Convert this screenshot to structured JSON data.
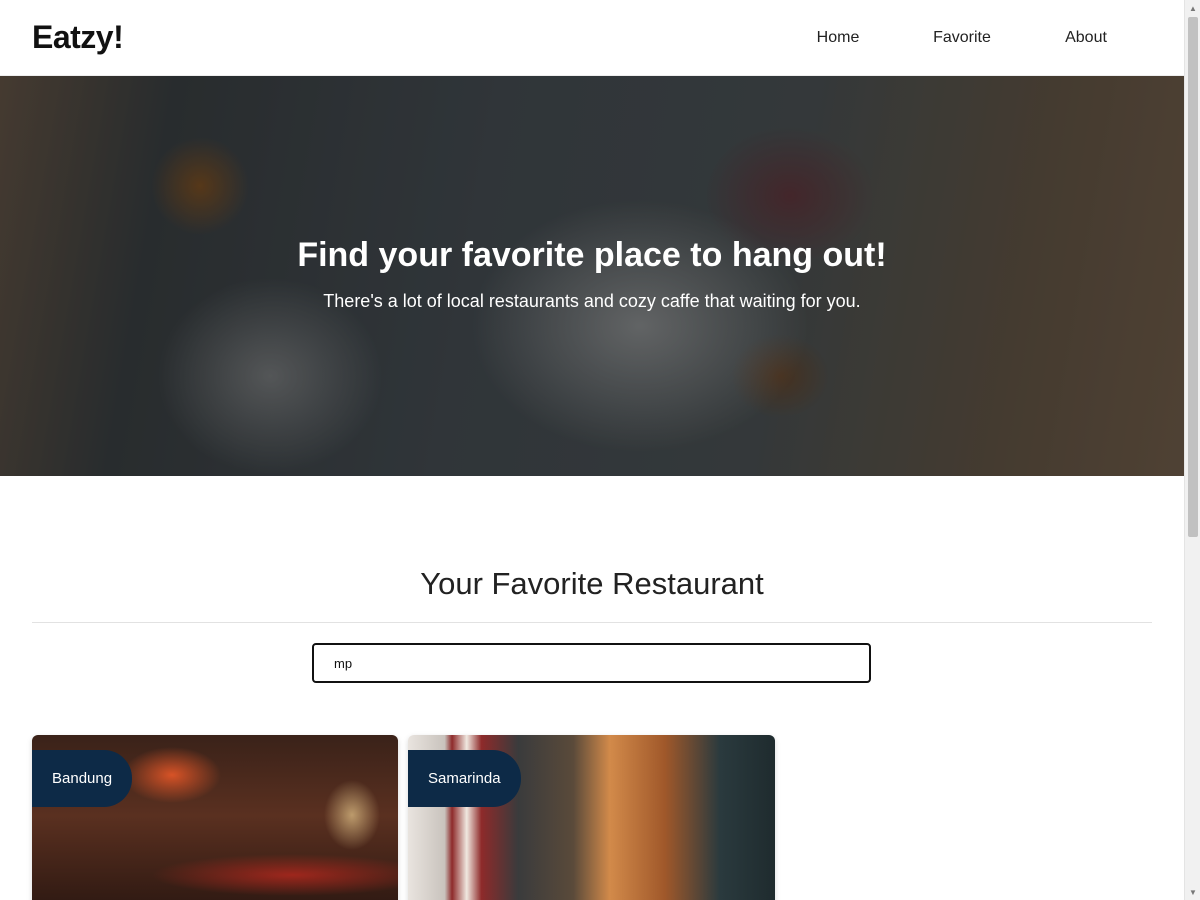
{
  "header": {
    "brand": "Eatzy!",
    "nav": [
      {
        "label": "Home"
      },
      {
        "label": "Favorite"
      },
      {
        "label": "About"
      }
    ]
  },
  "hero": {
    "title": "Find your favorite place to hang out!",
    "subtitle": "There's a lot of local restaurants and cozy caffe that waiting for you."
  },
  "main": {
    "section_title": "Your Favorite Restaurant",
    "search": {
      "value": "mp"
    },
    "cards": [
      {
        "city": "Bandung"
      },
      {
        "city": "Samarinda"
      }
    ]
  },
  "colors": {
    "badge": "#0d2a47",
    "search_border": "#111111"
  }
}
